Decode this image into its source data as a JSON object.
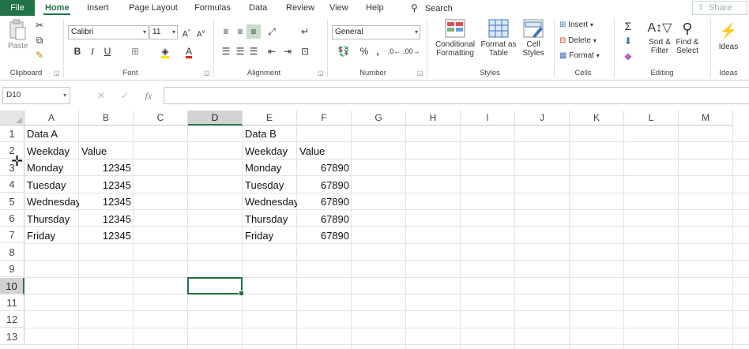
{
  "tabs": {
    "file": "File",
    "home": "Home",
    "insert": "Insert",
    "page_layout": "Page Layout",
    "formulas": "Formulas",
    "data": "Data",
    "review": "Review",
    "view": "View",
    "help": "Help",
    "search": "Search",
    "share": "Share"
  },
  "ribbon": {
    "clipboard": {
      "paste": "Paste",
      "label": "Clipboard"
    },
    "font": {
      "name": "Calibri",
      "size": "11",
      "label": "Font"
    },
    "alignment": {
      "label": "Alignment"
    },
    "number": {
      "format": "General",
      "label": "Number"
    },
    "styles": {
      "conditional_1": "Conditional",
      "conditional_2": "Formatting",
      "format_table_1": "Format as",
      "format_table_2": "Table",
      "cell_styles_1": "Cell",
      "cell_styles_2": "Styles",
      "label": "Styles"
    },
    "cells": {
      "insert": "Insert",
      "delete": "Delete",
      "format": "Format",
      "label": "Cells"
    },
    "editing": {
      "sort_1": "Sort &",
      "sort_2": "Filter",
      "find_1": "Find &",
      "find_2": "Select",
      "label": "Editing"
    },
    "ideas": {
      "button": "Ideas",
      "label": "Ideas"
    }
  },
  "formula_bar": {
    "name_box": "D10",
    "fx": "fx",
    "value": ""
  },
  "grid": {
    "columns": [
      "A",
      "B",
      "C",
      "D",
      "E",
      "F",
      "G",
      "H",
      "I",
      "J",
      "K",
      "L",
      "M"
    ],
    "rows": [
      "1",
      "2",
      "3",
      "4",
      "5",
      "6",
      "7",
      "8",
      "9",
      "10",
      "11",
      "12",
      "13"
    ],
    "selected_cell": "D10",
    "table_a": {
      "title": "Data A",
      "header_day": "Weekday",
      "header_value": "Value",
      "days": [
        "Monday",
        "Tuesday",
        "Wednesday",
        "Thursday",
        "Friday"
      ],
      "values": [
        "12345",
        "12345",
        "12345",
        "12345",
        "12345"
      ]
    },
    "table_b": {
      "title": "Data B",
      "header_day": "Weekday",
      "header_value": "Value",
      "days": [
        "Monday",
        "Tuesday",
        "Wednesday",
        "Thursday",
        "Friday"
      ],
      "values": [
        "67890",
        "67890",
        "67890",
        "67890",
        "67890"
      ]
    }
  },
  "colors": {
    "accent": "#217346"
  }
}
